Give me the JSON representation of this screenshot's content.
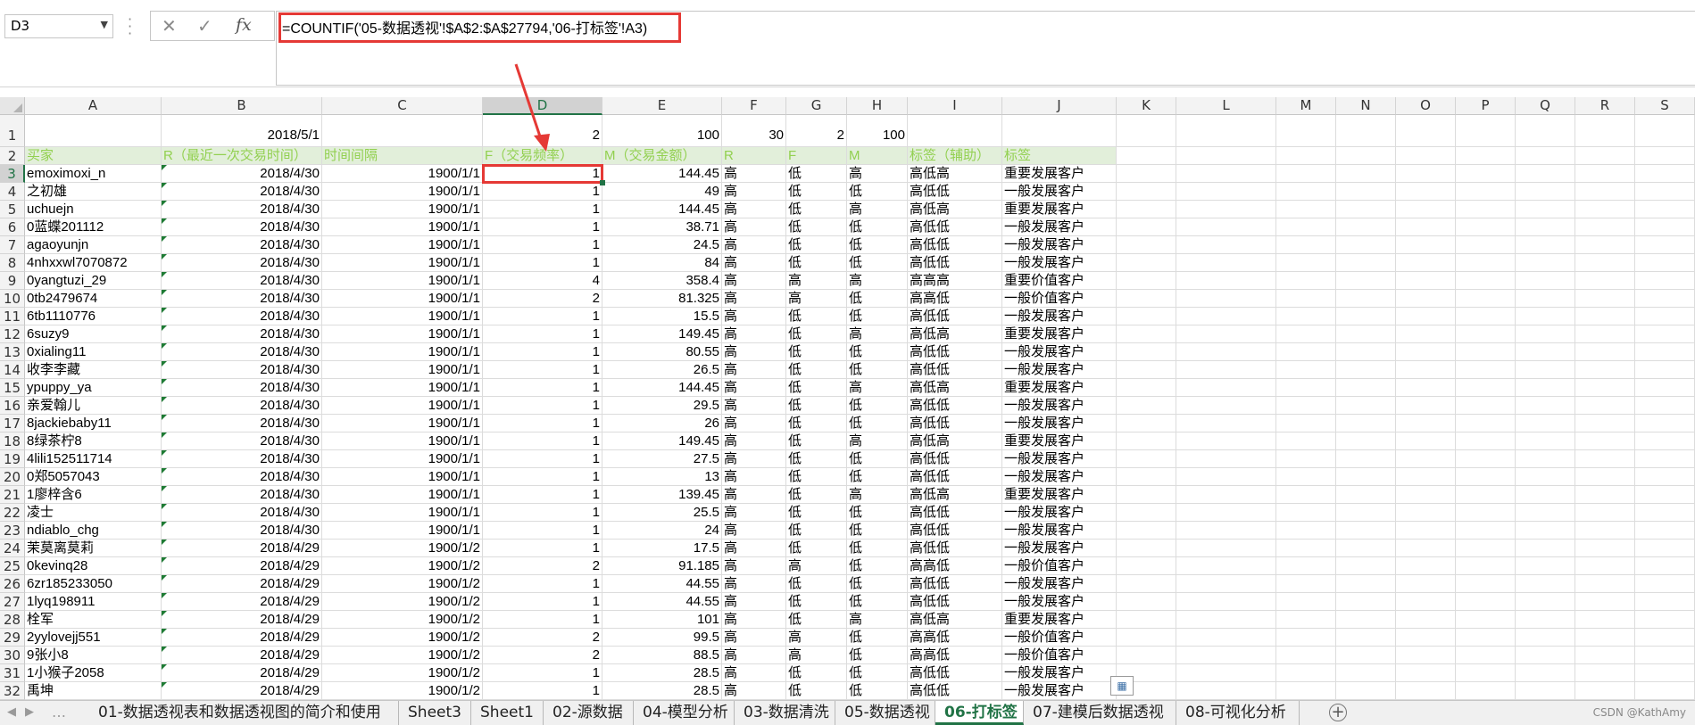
{
  "name_box": "D3",
  "formula": "=COUNTIF('05-数据透视'!$A$2:$A$27794,'06-打标签'!A3)",
  "fx_label": "fx",
  "icons": {
    "cancel": "close-icon",
    "enter": "check-icon",
    "function": "fx-icon"
  },
  "columns": [
    "A",
    "B",
    "C",
    "D",
    "E",
    "F",
    "G",
    "H",
    "I",
    "J",
    "K",
    "L",
    "M",
    "N",
    "O",
    "P",
    "Q",
    "R",
    "S"
  ],
  "selected_cell": {
    "column": "D",
    "row": 3
  },
  "row1": {
    "B": "2018/5/1",
    "D": "2",
    "E": "100",
    "F": "30",
    "G": "2",
    "H": "100"
  },
  "header_row": [
    "买家",
    "R（最近一次交易时间）",
    "时间间隔",
    "F（交易频率）",
    "M（交易金额）",
    "R",
    "F",
    "M",
    "标签（辅助）",
    "标签"
  ],
  "rows": [
    [
      "emoximoxi_n",
      "2018/4/30",
      "1900/1/1",
      "1",
      "144.45",
      "高",
      "低",
      "高",
      "高低高",
      "重要发展客户"
    ],
    [
      "之初雄",
      "2018/4/30",
      "1900/1/1",
      "1",
      "49",
      "高",
      "低",
      "低",
      "高低低",
      "一般发展客户"
    ],
    [
      "uchuejn",
      "2018/4/30",
      "1900/1/1",
      "1",
      "144.45",
      "高",
      "低",
      "高",
      "高低高",
      "重要发展客户"
    ],
    [
      "0蓝蝶201112",
      "2018/4/30",
      "1900/1/1",
      "1",
      "38.71",
      "高",
      "低",
      "低",
      "高低低",
      "一般发展客户"
    ],
    [
      "agaoyunjn",
      "2018/4/30",
      "1900/1/1",
      "1",
      "24.5",
      "高",
      "低",
      "低",
      "高低低",
      "一般发展客户"
    ],
    [
      "4nhxxwl7070872",
      "2018/4/30",
      "1900/1/1",
      "1",
      "84",
      "高",
      "低",
      "低",
      "高低低",
      "一般发展客户"
    ],
    [
      "0yangtuzi_29",
      "2018/4/30",
      "1900/1/1",
      "4",
      "358.4",
      "高",
      "高",
      "高",
      "高高高",
      "重要价值客户"
    ],
    [
      "0tb2479674",
      "2018/4/30",
      "1900/1/1",
      "2",
      "81.325",
      "高",
      "高",
      "低",
      "高高低",
      "一般价值客户"
    ],
    [
      "6tb1110776",
      "2018/4/30",
      "1900/1/1",
      "1",
      "15.5",
      "高",
      "低",
      "低",
      "高低低",
      "一般发展客户"
    ],
    [
      "6suzy9",
      "2018/4/30",
      "1900/1/1",
      "1",
      "149.45",
      "高",
      "低",
      "高",
      "高低高",
      "重要发展客户"
    ],
    [
      "0xialing11",
      "2018/4/30",
      "1900/1/1",
      "1",
      "80.55",
      "高",
      "低",
      "低",
      "高低低",
      "一般发展客户"
    ],
    [
      "收李李藏",
      "2018/4/30",
      "1900/1/1",
      "1",
      "26.5",
      "高",
      "低",
      "低",
      "高低低",
      "一般发展客户"
    ],
    [
      "ypuppy_ya",
      "2018/4/30",
      "1900/1/1",
      "1",
      "144.45",
      "高",
      "低",
      "高",
      "高低高",
      "重要发展客户"
    ],
    [
      "亲爱翰儿",
      "2018/4/30",
      "1900/1/1",
      "1",
      "29.5",
      "高",
      "低",
      "低",
      "高低低",
      "一般发展客户"
    ],
    [
      "8jackiebaby11",
      "2018/4/30",
      "1900/1/1",
      "1",
      "26",
      "高",
      "低",
      "低",
      "高低低",
      "一般发展客户"
    ],
    [
      "8绿茶柠8",
      "2018/4/30",
      "1900/1/1",
      "1",
      "149.45",
      "高",
      "低",
      "高",
      "高低高",
      "重要发展客户"
    ],
    [
      "4lili152511714",
      "2018/4/30",
      "1900/1/1",
      "1",
      "27.5",
      "高",
      "低",
      "低",
      "高低低",
      "一般发展客户"
    ],
    [
      "0郑5057043",
      "2018/4/30",
      "1900/1/1",
      "1",
      "13",
      "高",
      "低",
      "低",
      "高低低",
      "一般发展客户"
    ],
    [
      "1廖梓含6",
      "2018/4/30",
      "1900/1/1",
      "1",
      "139.45",
      "高",
      "低",
      "高",
      "高低高",
      "重要发展客户"
    ],
    [
      "凌士",
      "2018/4/30",
      "1900/1/1",
      "1",
      "25.5",
      "高",
      "低",
      "低",
      "高低低",
      "一般发展客户"
    ],
    [
      "ndiablo_chg",
      "2018/4/30",
      "1900/1/1",
      "1",
      "24",
      "高",
      "低",
      "低",
      "高低低",
      "一般发展客户"
    ],
    [
      "茉莫离莫莉",
      "2018/4/29",
      "1900/1/2",
      "1",
      "17.5",
      "高",
      "低",
      "低",
      "高低低",
      "一般发展客户"
    ],
    [
      "0kevinq28",
      "2018/4/29",
      "1900/1/2",
      "2",
      "91.185",
      "高",
      "高",
      "低",
      "高高低",
      "一般价值客户"
    ],
    [
      "6zr185233050",
      "2018/4/29",
      "1900/1/2",
      "1",
      "44.55",
      "高",
      "低",
      "低",
      "高低低",
      "一般发展客户"
    ],
    [
      "1lyq198911",
      "2018/4/29",
      "1900/1/2",
      "1",
      "44.55",
      "高",
      "低",
      "低",
      "高低低",
      "一般发展客户"
    ],
    [
      "栓军",
      "2018/4/29",
      "1900/1/2",
      "1",
      "101",
      "高",
      "低",
      "高",
      "高低高",
      "重要发展客户"
    ],
    [
      "2yylovejj551",
      "2018/4/29",
      "1900/1/2",
      "2",
      "99.5",
      "高",
      "高",
      "低",
      "高高低",
      "一般价值客户"
    ],
    [
      "9张小8",
      "2018/4/29",
      "1900/1/2",
      "2",
      "88.5",
      "高",
      "高",
      "低",
      "高高低",
      "一般价值客户"
    ],
    [
      "1小猴子2058",
      "2018/4/29",
      "1900/1/2",
      "1",
      "28.5",
      "高",
      "低",
      "低",
      "高低低",
      "一般发展客户"
    ],
    [
      "禹坤",
      "2018/4/29",
      "1900/1/2",
      "1",
      "28.5",
      "高",
      "低",
      "低",
      "高低低",
      "一般发展客户"
    ]
  ],
  "sheet_tabs": [
    "01-数据透视表和数据透视图的简介和使用",
    "Sheet3",
    "Sheet1",
    "02-源数据",
    "04-模型分析",
    "03-数据清洗",
    "05-数据透视",
    "06-打标签",
    "07-建模后数据透视",
    "08-可视化分析"
  ],
  "active_tab": "06-打标签",
  "watermark": "CSDN @KathAmy",
  "colors": {
    "accent": "#217346",
    "header_text": "#92d050",
    "highlight": "#e53935"
  }
}
